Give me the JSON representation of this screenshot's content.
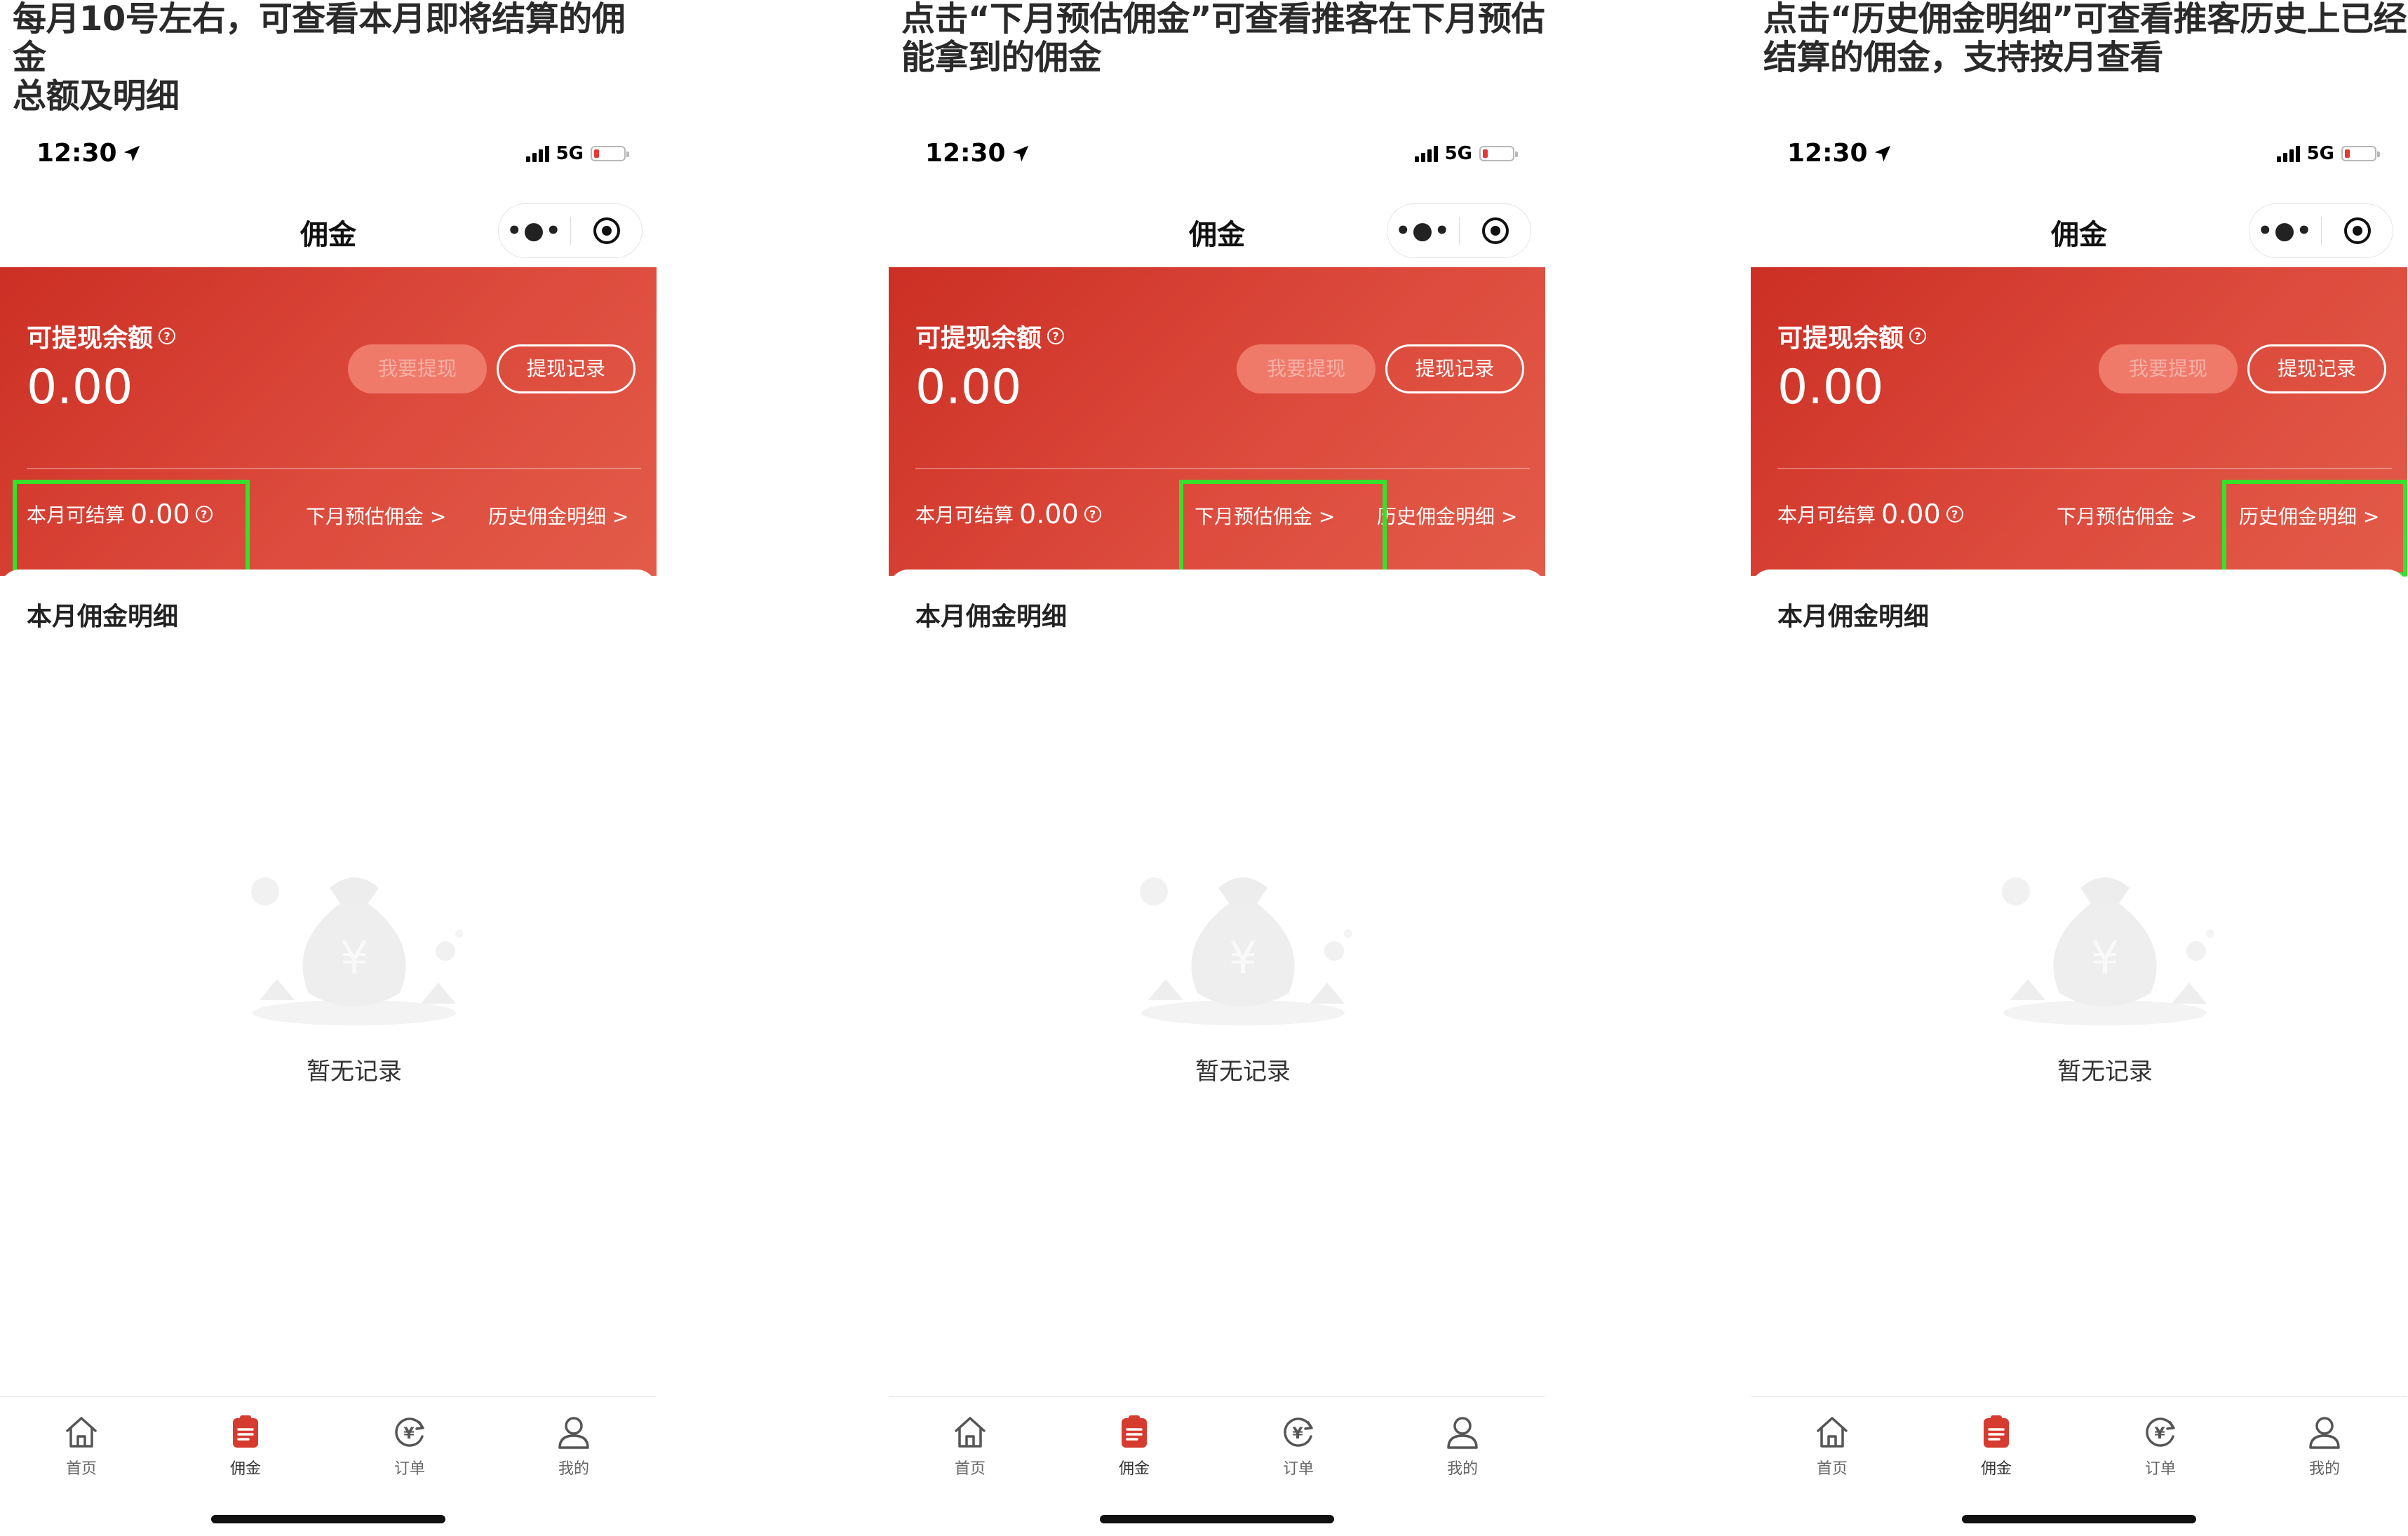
{
  "panels": [
    {
      "caption": "每月10号左右，可查看本月即将结算的佣金\n总额及明细",
      "highlight": "settle"
    },
    {
      "caption": "点击“下月预估佣金”可查看推客在下月预估\n能拿到的佣金",
      "highlight": "next"
    },
    {
      "caption": "点击“历史佣金明细”可查看推客历史上已经\n结算的佣金，支持按月查看",
      "highlight": "history"
    }
  ],
  "status_bar": {
    "time": "12:30",
    "network": "5G"
  },
  "nav": {
    "title": "佣金",
    "more_icon": "more-dots-icon",
    "close_icon": "capsule-close-icon"
  },
  "header": {
    "balance_label": "可提现余额",
    "balance_value": "0.00",
    "withdraw_button": "我要提现",
    "records_button": "提现记录",
    "settle_label": "本月可结算",
    "settle_value": "0.00",
    "next_month_link": "下月预估佣金 >",
    "history_link": "历史佣金明细 >"
  },
  "content": {
    "section_title": "本月佣金明细",
    "empty_text": "暂无记录"
  },
  "tabbar": [
    {
      "label": "首页",
      "icon": "home-icon"
    },
    {
      "label": "佣金",
      "icon": "commission-icon",
      "active": true
    },
    {
      "label": "订单",
      "icon": "order-icon"
    },
    {
      "label": "我的",
      "icon": "profile-icon"
    }
  ],
  "colors": {
    "brand_red": "#d63b2f",
    "highlight_green": "#36e02c"
  }
}
